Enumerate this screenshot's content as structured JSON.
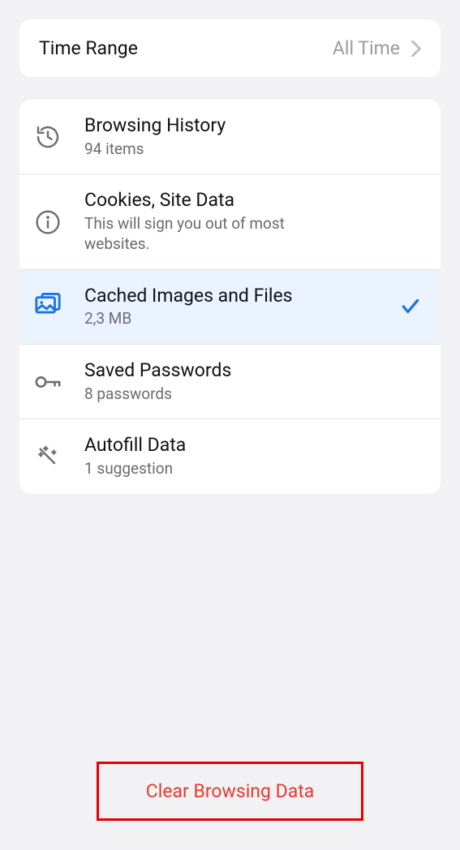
{
  "timeRange": {
    "label": "Time Range",
    "value": "All Time"
  },
  "items": [
    {
      "title": "Browsing History",
      "subtitle": "94 items"
    },
    {
      "title": "Cookies, Site Data",
      "subtitle": "This will sign you out of most websites."
    },
    {
      "title": "Cached Images and Files",
      "subtitle": "2,3 MB"
    },
    {
      "title": "Saved Passwords",
      "subtitle": "8 passwords"
    },
    {
      "title": "Autofill Data",
      "subtitle": "1 suggestion"
    }
  ],
  "clearButton": {
    "label": "Clear Browsing Data"
  }
}
